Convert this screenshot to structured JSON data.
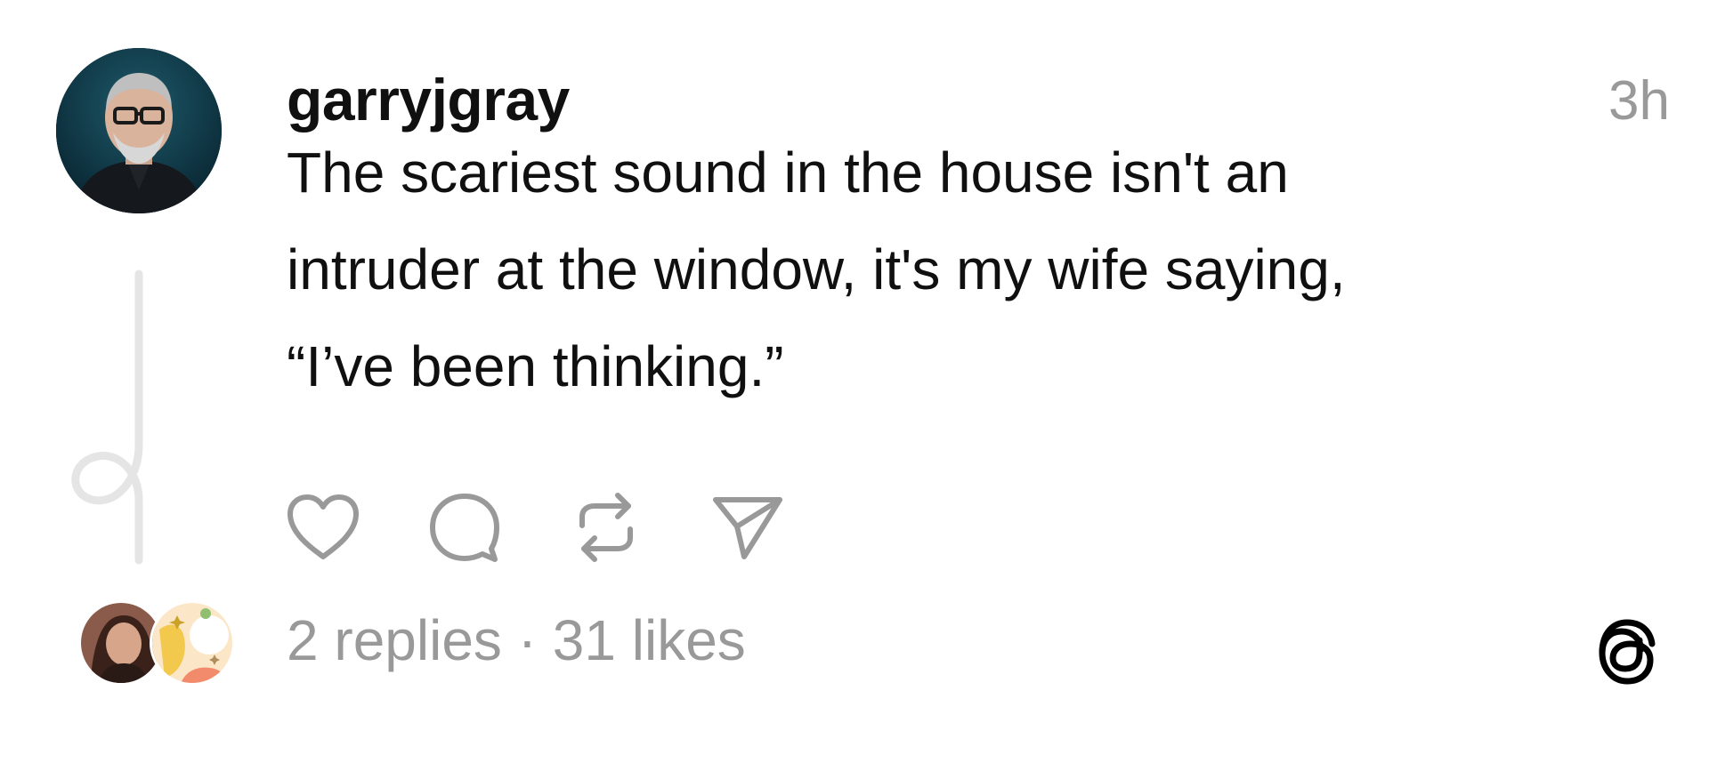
{
  "post": {
    "username": "garryjgray",
    "timestamp": "3h",
    "body_lines": [
      "The scariest sound in the house isn't an",
      "intruder at the window, it's my wife saying,",
      "“I’ve been thinking.”"
    ],
    "stats": {
      "replies": "2 replies",
      "separator": " · ",
      "likes": "31 likes"
    }
  },
  "icons": {
    "like": "heart-icon",
    "comment": "speech-bubble-icon",
    "repost": "repost-icon",
    "share": "send-icon",
    "brand": "threads-logo-icon",
    "thread": "thread-line-icon"
  },
  "colors": {
    "text": "#101010",
    "muted": "#999999",
    "icon": "#999999",
    "thread_line": "#e5e5e5",
    "background": "#ffffff"
  }
}
